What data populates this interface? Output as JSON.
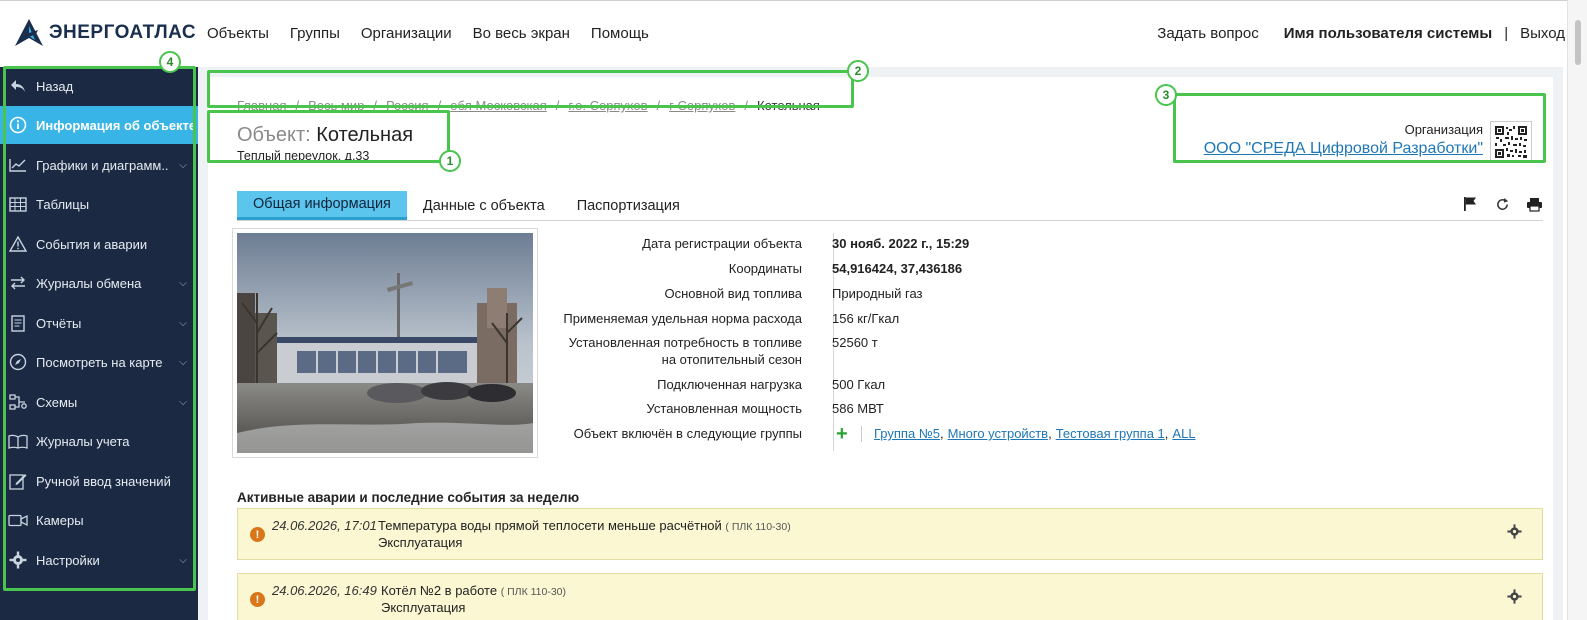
{
  "app": {
    "logo_text": "ЭНЕРГОАТЛАС"
  },
  "topnav": {
    "items": [
      "Объекты",
      "Группы",
      "Организации",
      "Во весь экран",
      "Помощь"
    ],
    "ask": "Задать вопрос",
    "user": "Имя пользователя системы",
    "separator": "|",
    "logout": "Выход"
  },
  "sidebar": {
    "items": [
      {
        "label": "Назад",
        "icon": "back-arrow-icon",
        "has_submenu": false
      },
      {
        "label": "Информация об объекте",
        "icon": "info-icon",
        "has_submenu": false,
        "active": true
      },
      {
        "label": "Графики и диаграмм...",
        "icon": "line-chart-icon",
        "has_submenu": true
      },
      {
        "label": "Таблицы",
        "icon": "table-icon",
        "has_submenu": false
      },
      {
        "label": "События и аварии",
        "icon": "warning-icon",
        "has_submenu": false
      },
      {
        "label": "Журналы обмена",
        "icon": "exchange-icon",
        "has_submenu": true
      },
      {
        "label": "Отчёты",
        "icon": "report-icon",
        "has_submenu": true
      },
      {
        "label": "Посмотреть на карте",
        "icon": "compass-icon",
        "has_submenu": true
      },
      {
        "label": "Схемы",
        "icon": "scheme-icon",
        "has_submenu": true
      },
      {
        "label": "Журналы учета",
        "icon": "book-icon",
        "has_submenu": false
      },
      {
        "label": "Ручной ввод значений",
        "icon": "edit-icon",
        "has_submenu": false
      },
      {
        "label": "Камеры",
        "icon": "camera-icon",
        "has_submenu": false
      },
      {
        "label": "Настройки",
        "icon": "gear-icon",
        "has_submenu": true
      }
    ]
  },
  "breadcrumb": {
    "links": [
      "Главная",
      "Весь мир",
      "Россия",
      "обл Московская",
      "г.о. Серпухов",
      "г Серпухов"
    ],
    "current": "Котельная",
    "separator": "/"
  },
  "object": {
    "label": "Объект:",
    "name": "Котельная",
    "address": "Теплый переулок, д.33"
  },
  "organization": {
    "label": "Организация",
    "name": "ООО \"СРЕДА Цифровой Разработки\""
  },
  "tabs": [
    "Общая информация",
    "Данные с объекта",
    "Паспортизация"
  ],
  "tab_icons": [
    "flag-icon",
    "refresh-icon",
    "print-icon"
  ],
  "properties": [
    {
      "name": "Дата регистрации объекта",
      "value": "30 нояб. 2022 г., 15:29",
      "bold": true
    },
    {
      "name": "Координаты",
      "value": "54,916424, 37,436186",
      "bold": true
    },
    {
      "name": "Основной вид топлива",
      "value": "Природный газ"
    },
    {
      "name": "Применяемая удельная норма расхода",
      "value": "156 кг/Гкал"
    },
    {
      "name": "Установленная потребность в топливе на отопительный сезон",
      "name_line1": "Установленная потребность в топливе",
      "name_line2": "на отопительный сезон",
      "value": "52560 т"
    },
    {
      "name": "Подключенная нагрузка",
      "value": "500 Гкал"
    },
    {
      "name": "Установленная мощность",
      "value": "586 МВТ"
    },
    {
      "name": "Объект включён в следующие группы",
      "value": ""
    }
  ],
  "groups": [
    "Группа №5",
    "Много устройств",
    "Тестовая группа 1",
    "ALL"
  ],
  "events": {
    "title": "Активные аварии и последние события за неделю",
    "items": [
      {
        "time": "24.06.2026, 17:01",
        "message": "Температура воды прямой теплосети меньше расчётной",
        "device": "( ПЛК 110-30)",
        "category": "Эксплуатация"
      },
      {
        "time": "24.06.2026, 16:49",
        "message": "Котёл №2 в работе",
        "device": "( ПЛК 110-30)",
        "category": "Эксплуатация"
      }
    ]
  },
  "annotations": [
    "1",
    "2",
    "3",
    "4"
  ],
  "colors": {
    "sidebar_bg": "#1b2a42",
    "active_accent": "#39b4e6",
    "annotation_green": "#49c44d",
    "link_blue": "#1f77b4",
    "event_bg": "#fbf7d3"
  }
}
